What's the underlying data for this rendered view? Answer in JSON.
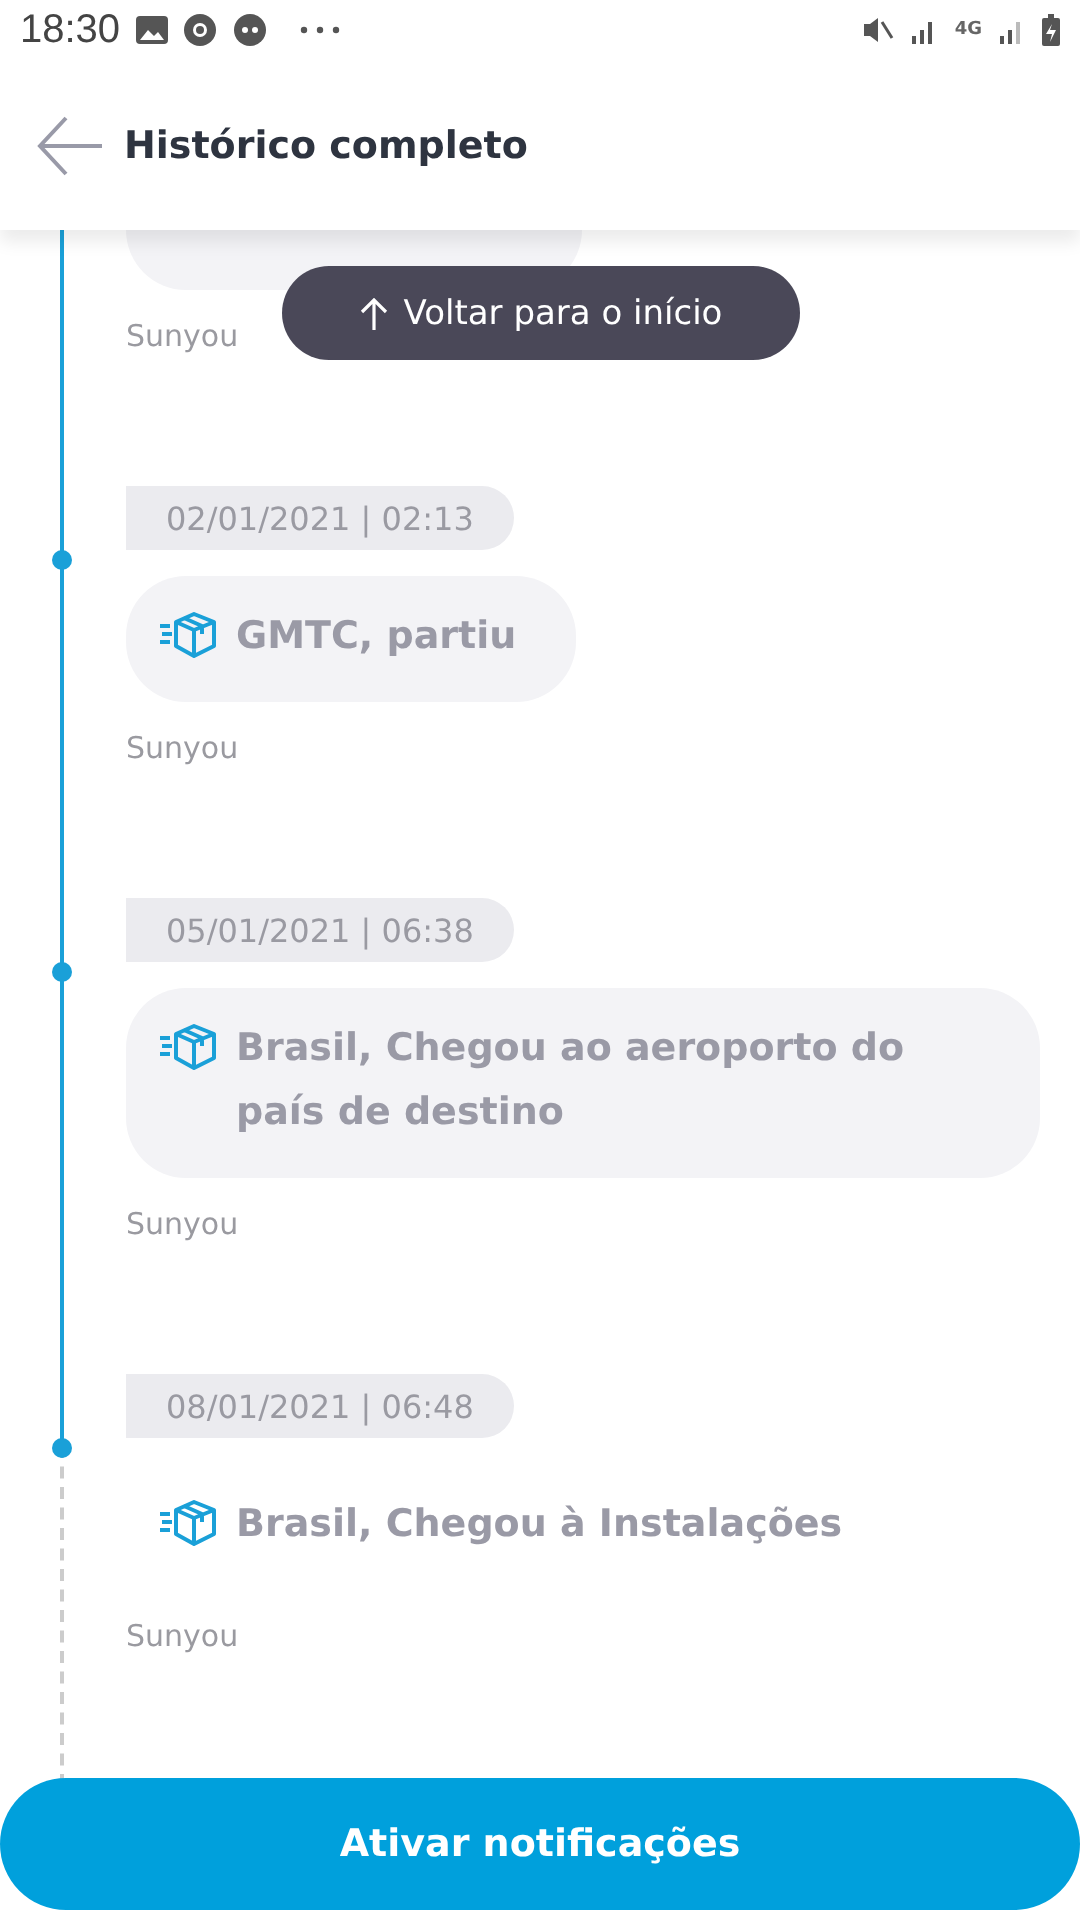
{
  "status_bar": {
    "time": "18:30",
    "network": "4G"
  },
  "header": {
    "title": "Histórico completo"
  },
  "scroll_top_button": {
    "label": "Voltar para o início"
  },
  "events": [
    {
      "kind": "past",
      "source": "Sunyou"
    },
    {
      "kind": "past",
      "date": "02/01/2021 | 02:13",
      "status": "GMTC, partiu",
      "source": "Sunyou"
    },
    {
      "kind": "past",
      "date": "05/01/2021 | 06:38",
      "status": "Brasil, Chegou ao aeroporto do país de destino",
      "source": "Sunyou"
    },
    {
      "kind": "latest",
      "date": "08/01/2021 | 06:48",
      "status": "Brasil, Chegou à Instalações",
      "source": "Sunyou"
    }
  ],
  "primary_button": {
    "label": "Ativar notificações"
  }
}
